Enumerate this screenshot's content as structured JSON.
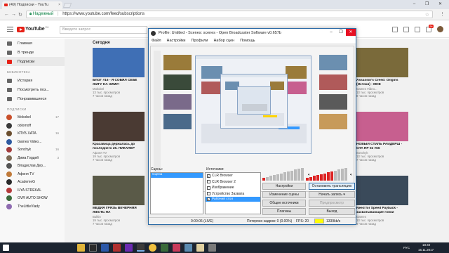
{
  "browser": {
    "tab_title": "(49) Подписки - YouTu",
    "tab_close": "×",
    "window_controls": "–  ❐  ✕",
    "secure_label": "Надежный",
    "url": "https://www.youtube.com/feed/subscriptions"
  },
  "youtube": {
    "logo_text": "YouTube",
    "logo_sup": "RU",
    "search_placeholder": "Введите запрос",
    "notif_count": "9+",
    "nav": [
      {
        "label": "Главная",
        "icon": "home-icon"
      },
      {
        "label": "В тренде",
        "icon": "trending-icon"
      },
      {
        "label": "Подписки",
        "icon": "subscriptions-icon",
        "active": true
      }
    ],
    "library_title": "БИБЛИОТЕКА",
    "library": [
      {
        "label": "История",
        "icon": "history-icon"
      },
      {
        "label": "Посмотреть поз...",
        "icon": "watch-later-icon"
      },
      {
        "label": "Понравившиеся",
        "icon": "liked-icon"
      }
    ],
    "subs_title": "ПОДПИСКИ",
    "subs": [
      {
        "name": "Mokobel",
        "count": "17",
        "color": "#c94f2a"
      },
      {
        "name": "oblomoff",
        "count": "",
        "color": "#3a3a3a"
      },
      {
        "name": "КПУБ ХАТА",
        "count": "16",
        "color": "#6a4e2f"
      },
      {
        "name": "Games Video...",
        "count": "",
        "color": "#2f5aa0"
      },
      {
        "name": "Sonchyk",
        "count": "16",
        "color": "#a33c3c"
      },
      {
        "name": "Дима Гордей",
        "count": "3",
        "color": "#7d6b55"
      },
      {
        "name": "Владислав Дер...",
        "count": "",
        "color": "#555"
      },
      {
        "name": "Афоня TV",
        "count": "",
        "color": "#c07a3a"
      },
      {
        "name": "AcademeG",
        "count": "",
        "color": "#2a2a2a"
      },
      {
        "name": "ILYA STREKAL",
        "count": "",
        "color": "#b43a3a"
      },
      {
        "name": "GVR AUTO SHOW",
        "count": "",
        "color": "#3c6b3c"
      },
      {
        "name": "TheLittleVlady",
        "count": "",
        "color": "#8e6bb0"
      }
    ],
    "section_today": "Сегодня",
    "videos": [
      {
        "title": "БЛОГ #16 - Я СОБЯЛ СЕБЕ ЖИГУ НА ЗИМУ!",
        "channel": "Mokobel",
        "views": "13 тыс. просмотров",
        "age": "7 часов назад",
        "dur": "",
        "color": "#3f6fb5"
      },
      {
        "title": "Красавица держалась до последнего 25. ПИКАПЕР",
        "channel": "Афоня TV",
        "views": "19 тыс. просмотров",
        "age": "7 часов назад",
        "dur": "",
        "color": "#4a3a33"
      },
      {
        "title": "МЕДИЯ ГРЯЗЬ ВЕЧЕРНЯЯ ЖЕСТЬ НА",
        "channel": "Bulkin",
        "views": "19 тыс. просмотров",
        "age": "7 часов назад",
        "dur": "",
        "color": "#5a5a48"
      },
      {
        "title": "Assassin's Creed: Origins (Истоки) - МНЕ",
        "channel": "Games Video...",
        "views": "13 тыс. просмотров",
        "age": "8 часов назад",
        "dur": "",
        "color": "#7a6a3a"
      },
      {
        "title": "НОВЫЙ СТИЛЬ РАЙДЕРШ - GTA RP 02 #66",
        "channel": "Sonchyk",
        "views": "13 тыс. просмотров",
        "age": "7 часов назад",
        "dur": "",
        "color": "#c75f8f"
      },
      {
        "title": "Need for Speed Payback - захватывающие гонки",
        "channel": "Games",
        "views": "13 тыс. просмотров",
        "age": "9 часов назад",
        "dur": "",
        "color": "#3a4a5a"
      }
    ]
  },
  "obs": {
    "title": "Profile: Untitled - Scenes: scenes - Open Broadcaster Software v0.657b",
    "menu": [
      "Файл",
      "Настройки",
      "Профили",
      "Набор сцен",
      "Помощь"
    ],
    "scenes_label": "Сцены:",
    "scenes": [
      "Сцена"
    ],
    "sources_label": "Источники:",
    "sources": [
      {
        "label": "CLR Browser",
        "checked": true,
        "selected": false
      },
      {
        "label": "CLR Browser 2",
        "checked": false,
        "selected": false
      },
      {
        "label": "Изображение",
        "checked": false,
        "selected": false
      },
      {
        "label": "Устройство Захвата",
        "checked": false,
        "selected": false
      },
      {
        "label": "Рабочий стол",
        "checked": true,
        "selected": true
      }
    ],
    "buttons": {
      "settings": "Настройки",
      "stop_stream": "Остановить трансляцию",
      "edit_scene": "Изменение сцены",
      "start_record": "Начать запись",
      "global_sources": "Общие источники",
      "preview": "Предпросмотр",
      "plugins": "Плагины",
      "exit": "Выход"
    },
    "status": {
      "time": "0:00:06 (LIVE)",
      "dropped": "Потеряно кадров: 0 (0.00%)",
      "fps": "FPS: 20",
      "bitrate": "1339kb/s"
    }
  },
  "taskbar": {
    "lang": "РУС",
    "time": "18:40",
    "date": "15.11.2017"
  }
}
